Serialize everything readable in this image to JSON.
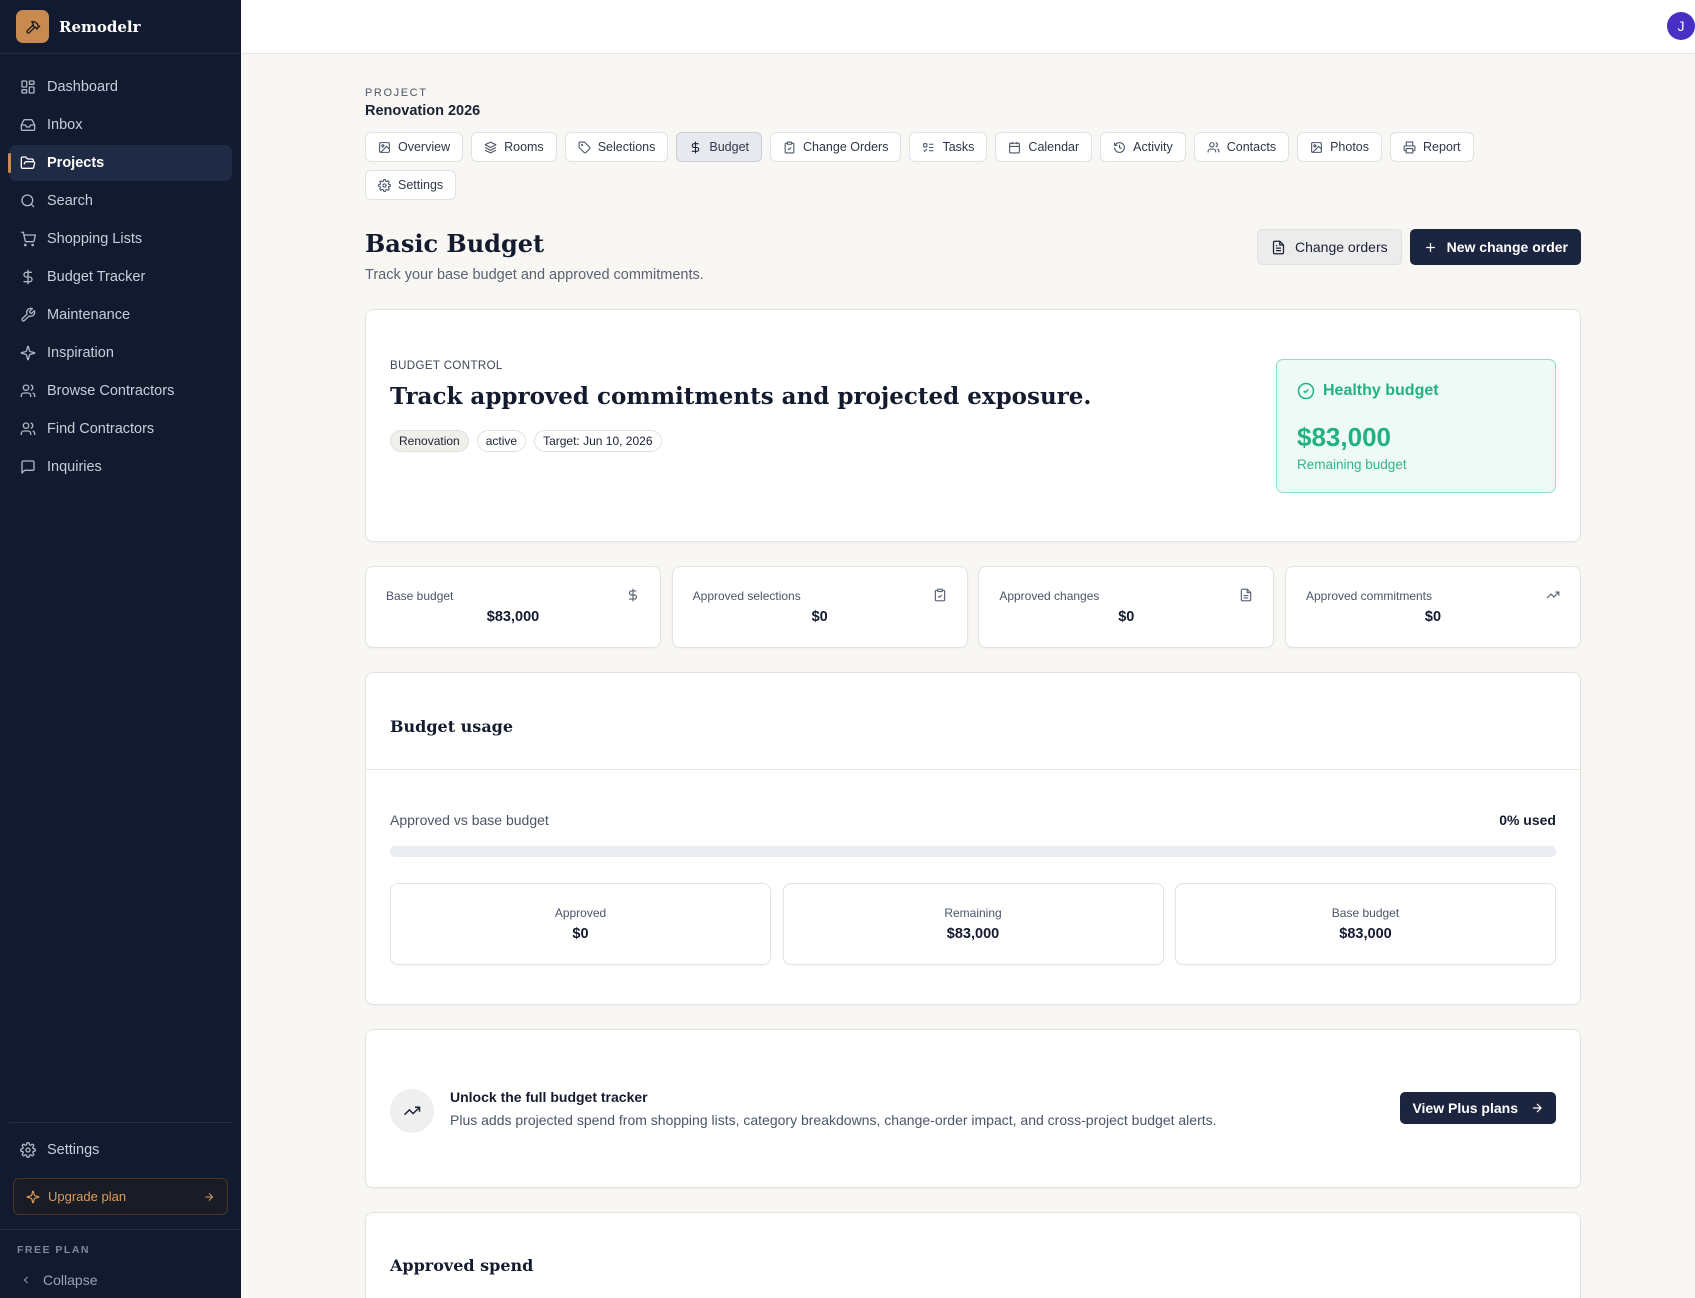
{
  "app": {
    "name": "Remodelr",
    "user_initial": "J"
  },
  "sidebar": {
    "items": [
      {
        "label": "Dashboard",
        "icon": "grid-icon"
      },
      {
        "label": "Inbox",
        "icon": "inbox-icon"
      },
      {
        "label": "Projects",
        "icon": "folder-icon",
        "active": true
      },
      {
        "label": "Search",
        "icon": "search-icon"
      },
      {
        "label": "Shopping Lists",
        "icon": "cart-icon"
      },
      {
        "label": "Budget Tracker",
        "icon": "dollar-icon"
      },
      {
        "label": "Maintenance",
        "icon": "wrench-icon"
      },
      {
        "label": "Inspiration",
        "icon": "sparkles-icon"
      },
      {
        "label": "Browse Contractors",
        "icon": "users-icon"
      },
      {
        "label": "Find Contractors",
        "icon": "users-icon"
      },
      {
        "label": "Inquiries",
        "icon": "message-icon"
      }
    ],
    "settings_label": "Settings",
    "upgrade_label": "Upgrade plan",
    "plan_label": "FREE PLAN",
    "collapse_label": "Collapse"
  },
  "project": {
    "kicker": "PROJECT",
    "name": "Renovation 2026",
    "tabs": [
      {
        "label": "Overview",
        "icon": "image-icon"
      },
      {
        "label": "Rooms",
        "icon": "layers-icon"
      },
      {
        "label": "Selections",
        "icon": "tag-icon"
      },
      {
        "label": "Budget",
        "icon": "dollar-icon",
        "active": true
      },
      {
        "label": "Change Orders",
        "icon": "clipboard-icon"
      },
      {
        "label": "Tasks",
        "icon": "list-icon"
      },
      {
        "label": "Calendar",
        "icon": "calendar-icon"
      },
      {
        "label": "Activity",
        "icon": "history-icon"
      },
      {
        "label": "Contacts",
        "icon": "users-icon"
      },
      {
        "label": "Photos",
        "icon": "image-icon"
      },
      {
        "label": "Report",
        "icon": "printer-icon"
      },
      {
        "label": "Settings",
        "icon": "gear-icon"
      }
    ]
  },
  "page": {
    "title": "Basic Budget",
    "subtitle": "Track your base budget and approved commitments.",
    "change_orders_btn": "Change orders",
    "new_change_order_btn": "New change order"
  },
  "control": {
    "kicker": "BUDGET CONTROL",
    "title": "Track approved commitments and projected exposure.",
    "chips": [
      "Renovation",
      "active",
      "Target: Jun 10, 2026"
    ],
    "health_title": "Healthy budget",
    "health_amount": "$83,000",
    "health_label": "Remaining budget"
  },
  "stats": [
    {
      "label": "Base budget",
      "value": "$83,000",
      "icon": "dollar-icon"
    },
    {
      "label": "Approved selections",
      "value": "$0",
      "icon": "clipboard-check-icon"
    },
    {
      "label": "Approved changes",
      "value": "$0",
      "icon": "file-text-icon"
    },
    {
      "label": "Approved commitments",
      "value": "$0",
      "icon": "trending-up-icon"
    }
  ],
  "usage": {
    "title": "Budget usage",
    "row_label": "Approved vs base budget",
    "used_label": "0% used",
    "used_fraction": 0,
    "minis": [
      {
        "label": "Approved",
        "value": "$0"
      },
      {
        "label": "Remaining",
        "value": "$83,000"
      },
      {
        "label": "Base budget",
        "value": "$83,000"
      }
    ]
  },
  "unlock": {
    "title": "Unlock the full budget tracker",
    "text": "Plus adds projected spend from shopping lists, category breakdowns, change-order impact, and cross-project budget alerts.",
    "button": "View Plus plans"
  },
  "spend": {
    "title": "Approved spend"
  },
  "colors": {
    "sidebar_bg": "#111a2e",
    "accent": "#c98a4f",
    "primary": "#1c2540",
    "success": "#22b27f"
  }
}
